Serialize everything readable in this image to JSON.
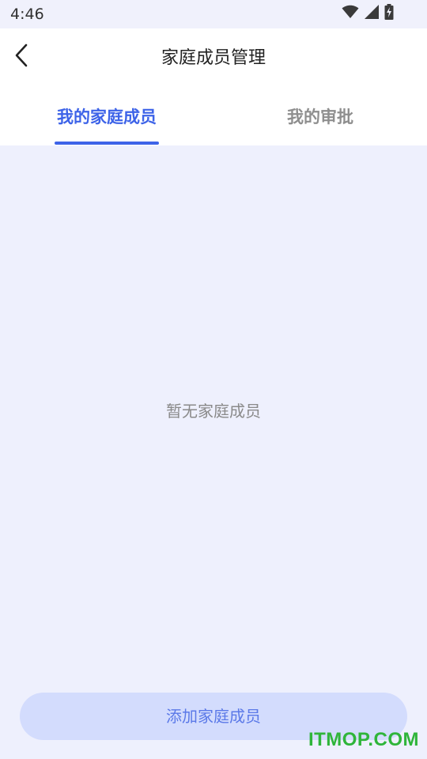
{
  "status_bar": {
    "time": "4:46"
  },
  "header": {
    "title": "家庭成员管理"
  },
  "tabs": [
    {
      "label": "我的家庭成员",
      "active": true
    },
    {
      "label": "我的审批",
      "active": false
    }
  ],
  "content": {
    "empty_text": "暂无家庭成员"
  },
  "actions": {
    "add_label": "添加家庭成员"
  },
  "watermark": {
    "text": "ITMOP.COM"
  },
  "colors": {
    "accent": "#3d63e8",
    "background": "#eef0fd",
    "button_bg": "#d3dcfd",
    "watermark": "#2fb53a"
  }
}
